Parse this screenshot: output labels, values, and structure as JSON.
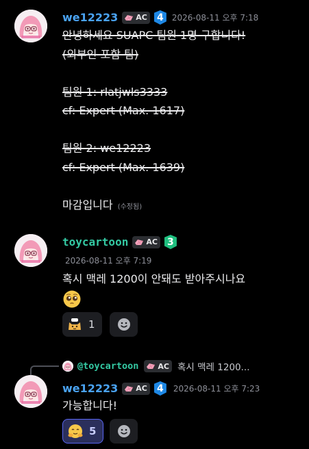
{
  "messages": [
    {
      "username": "we12223",
      "badge_ac": "AC",
      "tier": "4",
      "timestamp": "2026-08-11 오후 7:18",
      "lines": [
        "안녕하세요 SUAPC 팀원 1명 구합니다!",
        "(외부인 포함 팀)",
        "",
        "팀원 1: rlatjwls3333",
        "cf: Expert (Max. 1617)",
        "",
        "팀원 2: we12223",
        "cf: Expert (Max. 1639)",
        "",
        "마감입니다"
      ],
      "edited": "(수정됨)"
    },
    {
      "username": "toycartoon",
      "badge_ac": "AC",
      "tier": "3",
      "timestamp": "2026-08-11 오후 7:19",
      "text": "혹시 맥레 1200이 안돼도 받아주시나요",
      "reaction_count": "1"
    },
    {
      "reply_to_user": "@toycartoon",
      "reply_badge_ac": "AC",
      "reply_preview": "혹시 맥레 1200...",
      "username": "we12223",
      "badge_ac": "AC",
      "tier": "4",
      "timestamp": "2026-08-11 오후 7:23",
      "text": "가능합니다!",
      "reaction_count": "5"
    }
  ],
  "colors": {
    "background": "#000000",
    "username_blue": "#4aa3f2",
    "username_green": "#34c9a3",
    "tier_blue": "#1e88e5",
    "tier_green": "#1fbf7f",
    "reaction_active_border": "#5865f2"
  },
  "icons": [
    "pink-hair-girl-avatar",
    "pink-gem-icon",
    "pleading-face-emoji",
    "cat-emoji",
    "hug-emoji",
    "add-reaction-icon"
  ]
}
